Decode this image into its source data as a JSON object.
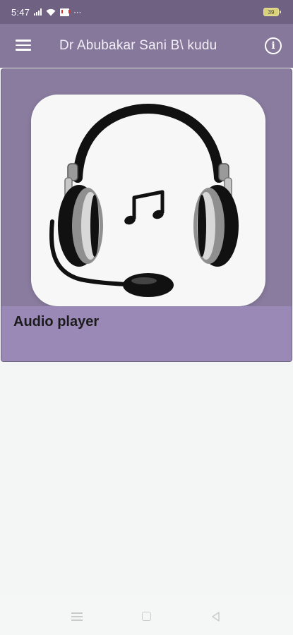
{
  "status_bar": {
    "time": "5:47",
    "notification_dots": "⋯",
    "battery_level": "39",
    "icons": [
      "signal-icon",
      "wifi-icon",
      "gmail-icon",
      "battery-icon"
    ]
  },
  "app_bar": {
    "title": "Dr Abubakar Sani B\\ kudu",
    "menu_icon": "hamburger-menu-icon",
    "info_icon": "info-icon",
    "info_glyph": "i"
  },
  "cards": [
    {
      "label": "Audio player",
      "image": "headphones-music-icon"
    }
  ],
  "nav_bar": {
    "icons": [
      "recents-icon",
      "home-icon",
      "back-icon"
    ]
  },
  "colors": {
    "status_bar": "#6e6182",
    "app_bar": "#86789b",
    "card_background": "#8a7c9f",
    "card_footer": "#9a89b6",
    "page_background": "#f3f6f4"
  }
}
